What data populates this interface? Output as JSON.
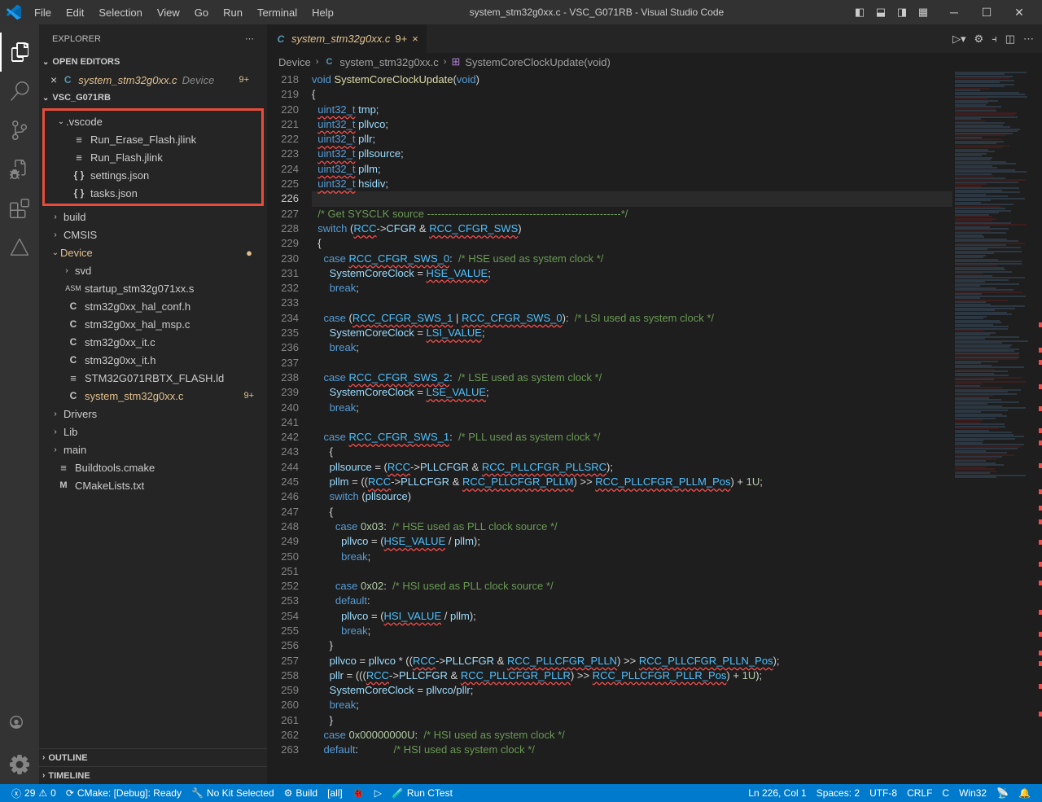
{
  "title": "system_stm32g0xx.c - VSC_G071RB - Visual Studio Code",
  "menu": [
    "File",
    "Edit",
    "Selection",
    "View",
    "Go",
    "Run",
    "Terminal",
    "Help"
  ],
  "sidebar": {
    "title": "EXPLORER",
    "sections": {
      "open_editors": "OPEN EDITORS",
      "open_editor_file": "system_stm32g0xx.c",
      "open_editor_path": "Device",
      "open_editor_badge": "9+",
      "workspace": "VSC_G071RB",
      "outline": "OUTLINE",
      "timeline": "TIMELINE"
    },
    "tree": {
      "vscode": ".vscode",
      "vscode_files": [
        "Run_Erase_Flash.jlink",
        "Run_Flash.jlink",
        "settings.json",
        "tasks.json"
      ],
      "build": "build",
      "cmsis": "CMSIS",
      "device": "Device",
      "svd": "svd",
      "device_files": [
        "startup_stm32g071xx.s",
        "stm32g0xx_hal_conf.h",
        "stm32g0xx_hal_msp.c",
        "stm32g0xx_it.c",
        "stm32g0xx_it.h",
        "STM32G071RBTX_FLASH.ld",
        "system_stm32g0xx.c"
      ],
      "device_badge": "9+",
      "drivers": "Drivers",
      "lib": "Lib",
      "main": "main",
      "root_files": [
        "Buildtools.cmake",
        "CMakeLists.txt"
      ],
      "device_dot": "●"
    }
  },
  "tab": {
    "file": "system_stm32g0xx.c",
    "badge": "9+"
  },
  "breadcrumb": {
    "parts": [
      "Device",
      "system_stm32g0xx.c",
      "SystemCoreClockUpdate(void)"
    ]
  },
  "line_start": 218,
  "line_end": 263,
  "statusbar": {
    "errors": "29",
    "warnings": "0",
    "cmake": "CMake: [Debug]: Ready",
    "kit": "No Kit Selected",
    "build": "Build",
    "target": "[all]",
    "ctest": "Run CTest",
    "position": "Ln 226, Col 1",
    "spaces": "Spaces: 2",
    "encoding": "UTF-8",
    "eol": "CRLF",
    "lang": "C",
    "os": "Win32"
  }
}
